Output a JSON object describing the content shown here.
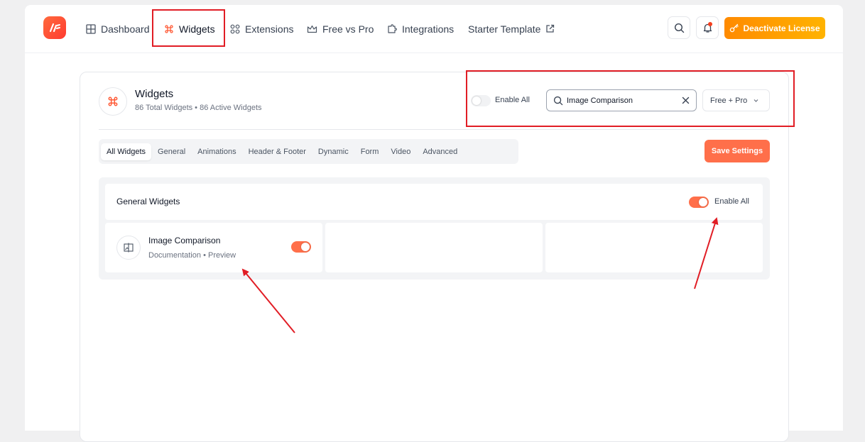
{
  "nav": {
    "items": [
      {
        "label": "Dashboard",
        "icon": "grid-icon"
      },
      {
        "label": "Widgets",
        "icon": "command-icon",
        "active": true
      },
      {
        "label": "Extensions",
        "icon": "extensions-icon"
      },
      {
        "label": "Free vs Pro",
        "icon": "crown-icon"
      },
      {
        "label": "Integrations",
        "icon": "puzzle-icon"
      },
      {
        "label": "Starter Template",
        "icon": "external-link-icon"
      }
    ],
    "license_button": "Deactivate License"
  },
  "panel": {
    "title": "Widgets",
    "subtitle": "86 Total Widgets • 86 Active Widgets",
    "enable_all_label": "Enable All",
    "enable_all_on": false,
    "search": {
      "value": "Image Comparison",
      "placeholder": "Search"
    },
    "filter": "Free + Pro"
  },
  "tabs": [
    "All Widgets",
    "General",
    "Animations",
    "Header & Footer",
    "Dynamic",
    "Form",
    "Video",
    "Advanced"
  ],
  "save_button": "Save Settings",
  "group": {
    "title": "General Widgets",
    "enable_all_label": "Enable All",
    "enable_all_on": true,
    "widgets": [
      {
        "name": "Image Comparison",
        "doc": "Documentation",
        "sep": "•",
        "preview": "Preview",
        "enabled": true
      }
    ]
  },
  "colors": {
    "accent": "#ff6f4a",
    "license": "#ff9800",
    "annotation": "#e11d25"
  }
}
